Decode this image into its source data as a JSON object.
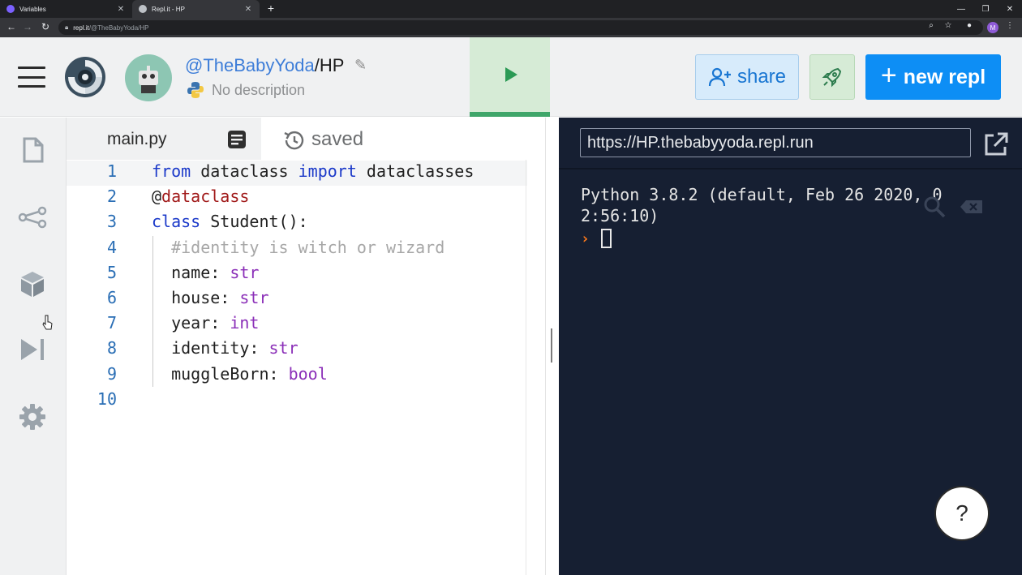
{
  "browser": {
    "tabs": [
      {
        "label": "Variables",
        "favicon_color": "#7b61ff",
        "close": "✕"
      },
      {
        "label": "Repl.it - HP",
        "favicon_color": "#bdc1c6",
        "close": "✕"
      }
    ],
    "new_tab": "+",
    "window_controls": [
      "—",
      "❐",
      "✕"
    ],
    "nav_icons": [
      "back-icon",
      "forward-icon",
      "reload-icon"
    ],
    "url_host": "repl.it",
    "url_path": "/@TheBabyYoda/HP",
    "profile_initial": "M"
  },
  "header": {
    "user": "@TheBabyYoda",
    "slash": "/",
    "repl_name": "HP",
    "description": "No description",
    "share_label": "share",
    "new_repl_label": "new repl",
    "new_repl_plus": "+",
    "colors": {
      "run_bg": "#d6ebd6",
      "run_icon": "#2b9a55",
      "share_text": "#1976d2",
      "new_repl_bg": "#0d8ef5"
    }
  },
  "sidebar": {
    "items": [
      "files-icon",
      "version-control-icon",
      "packages-icon",
      "debugger-icon",
      "settings-icon"
    ]
  },
  "editor": {
    "file_name": "main.py",
    "save_status": "saved",
    "line_numbers": [
      "1",
      "2",
      "3",
      "4",
      "5",
      "6",
      "7",
      "8",
      "9",
      "10"
    ],
    "lines": [
      [
        {
          "t": "from",
          "c": "kw"
        },
        {
          "t": " dataclass ",
          "c": ""
        },
        {
          "t": "import",
          "c": "kw"
        },
        {
          "t": " dataclasses",
          "c": ""
        }
      ],
      [
        {
          "t": "@",
          "c": ""
        },
        {
          "t": "dataclass",
          "c": "deco"
        }
      ],
      [
        {
          "t": "class",
          "c": "kw"
        },
        {
          "t": " Student():",
          "c": ""
        }
      ],
      [
        {
          "t": "  #identity is witch or wizard",
          "c": "cmt"
        }
      ],
      [
        {
          "t": "  name: ",
          "c": ""
        },
        {
          "t": "str",
          "c": "typ"
        }
      ],
      [
        {
          "t": "  house: ",
          "c": ""
        },
        {
          "t": "str",
          "c": "typ"
        }
      ],
      [
        {
          "t": "  year: ",
          "c": ""
        },
        {
          "t": "int",
          "c": "typ"
        }
      ],
      [
        {
          "t": "  identity: ",
          "c": ""
        },
        {
          "t": "str",
          "c": "typ"
        }
      ],
      [
        {
          "t": "  muggleBorn: ",
          "c": ""
        },
        {
          "t": "bool",
          "c": "typ"
        }
      ],
      []
    ]
  },
  "console": {
    "url": "https://HP.thebabyyoda.repl.run",
    "output": "Python 3.8.2 (default, Feb 26 2020, 0\n2:56:10)",
    "prompt": "›",
    "help_label": "?",
    "colors": {
      "background": "#161f32",
      "prompt": "#ff7a1a"
    }
  }
}
